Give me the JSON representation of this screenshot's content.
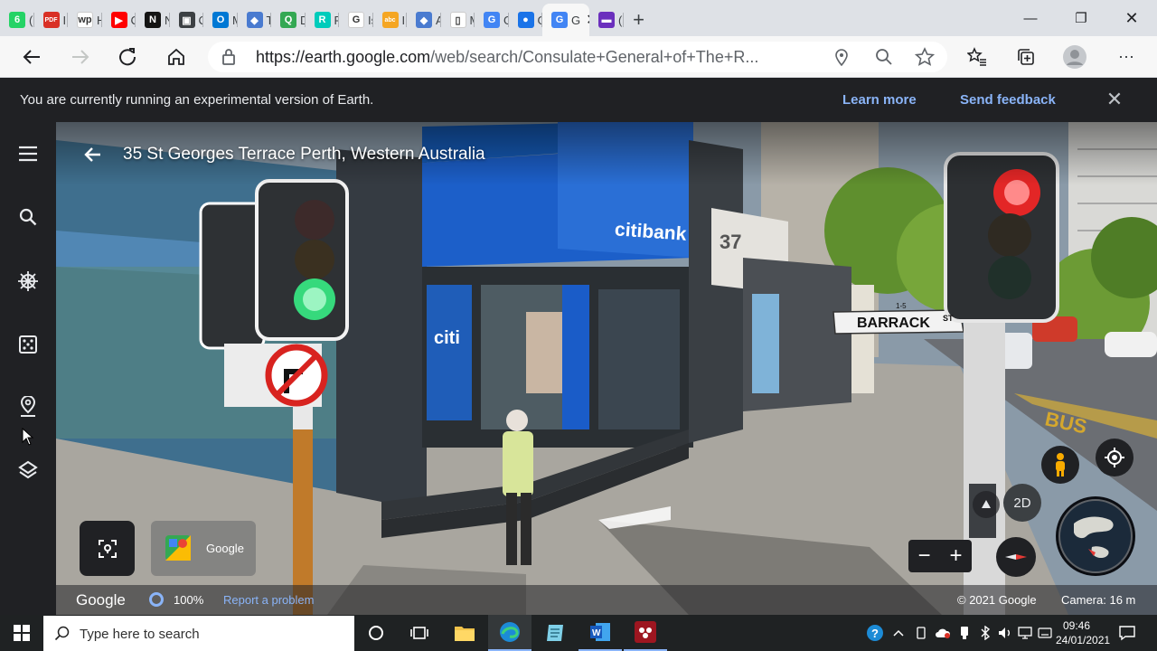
{
  "browser": {
    "tabs": [
      {
        "icon": "whatsapp-icon",
        "label": "(6",
        "color": "#25D366",
        "glyph": "6"
      },
      {
        "icon": "pdf-icon",
        "label": "In",
        "color": "#d93025",
        "glyph": "PDF"
      },
      {
        "icon": "wp-icon",
        "label": "H",
        "color": "#ffffff",
        "glyph": "wp"
      },
      {
        "icon": "youtube-icon",
        "label": "Cl",
        "color": "#ff0000",
        "glyph": "▶"
      },
      {
        "icon": "netflix-icon",
        "label": "N",
        "color": "#141414",
        "glyph": "N"
      },
      {
        "icon": "contact-card-icon",
        "label": "Cl",
        "color": "#3c4043",
        "glyph": "▣"
      },
      {
        "icon": "outlook-icon",
        "label": "M",
        "color": "#0078d4",
        "glyph": "O"
      },
      {
        "icon": "diamond-icon",
        "label": "Tl",
        "color": "#4a7bd0",
        "glyph": "◆"
      },
      {
        "icon": "magnifier-green-icon",
        "label": "D",
        "color": "#34a853",
        "glyph": "Q"
      },
      {
        "icon": "researchgate-icon",
        "label": "Fa",
        "color": "#00ccbb",
        "glyph": "R"
      },
      {
        "icon": "google-icon",
        "label": "Is",
        "color": "#ffffff",
        "glyph": "G"
      },
      {
        "icon": "abc-icon",
        "label": "In",
        "color": "#f5a623",
        "glyph": "abc"
      },
      {
        "icon": "diamond-icon",
        "label": "A",
        "color": "#4a7bd0",
        "glyph": "◆"
      },
      {
        "icon": "document-icon",
        "label": "M",
        "color": "#ffffff",
        "glyph": "▯"
      },
      {
        "icon": "google-translate-icon",
        "label": "G",
        "color": "#4285f4",
        "glyph": "G"
      },
      {
        "icon": "earth-icon",
        "label": "G",
        "color": "#1a73e8",
        "glyph": "●"
      }
    ],
    "active_tab": {
      "label": "G",
      "icon": "google-earth-icon"
    },
    "trailing_tab": {
      "label": "(3",
      "icon": "mail-icon",
      "color": "#6b2fbd"
    },
    "url_host": "https://earth.google.com",
    "url_path": "/web/search/Consulate+General+of+The+R..."
  },
  "banner": {
    "message": "You are currently running an experimental version of Earth.",
    "learn_more": "Learn more",
    "send_feedback": "Send feedback"
  },
  "streetview": {
    "title": "35 St Georges Terrace Perth, Western Australia",
    "google_word": "Google",
    "zoom_pct": "100%",
    "report": "Report a problem",
    "copyright": "© 2021 Google",
    "camera": "Camera: 16 m",
    "card_label": "Google",
    "two_d": "2D",
    "zoom_minus": "−",
    "zoom_plus": "+",
    "scene_text": {
      "citibank_sign": "citibank",
      "citi_panel": "citi",
      "building_number": "37",
      "street_sign": "BARRACK",
      "street_sign_suffix": "ST",
      "street_sign_range": "1-5",
      "bus_marking": "BUS"
    }
  },
  "taskbar": {
    "search_placeholder": "Type here to search",
    "time": "09:46",
    "date": "24/01/2021"
  },
  "colors": {
    "accent": "#8ab4f8",
    "dark": "#202124"
  }
}
